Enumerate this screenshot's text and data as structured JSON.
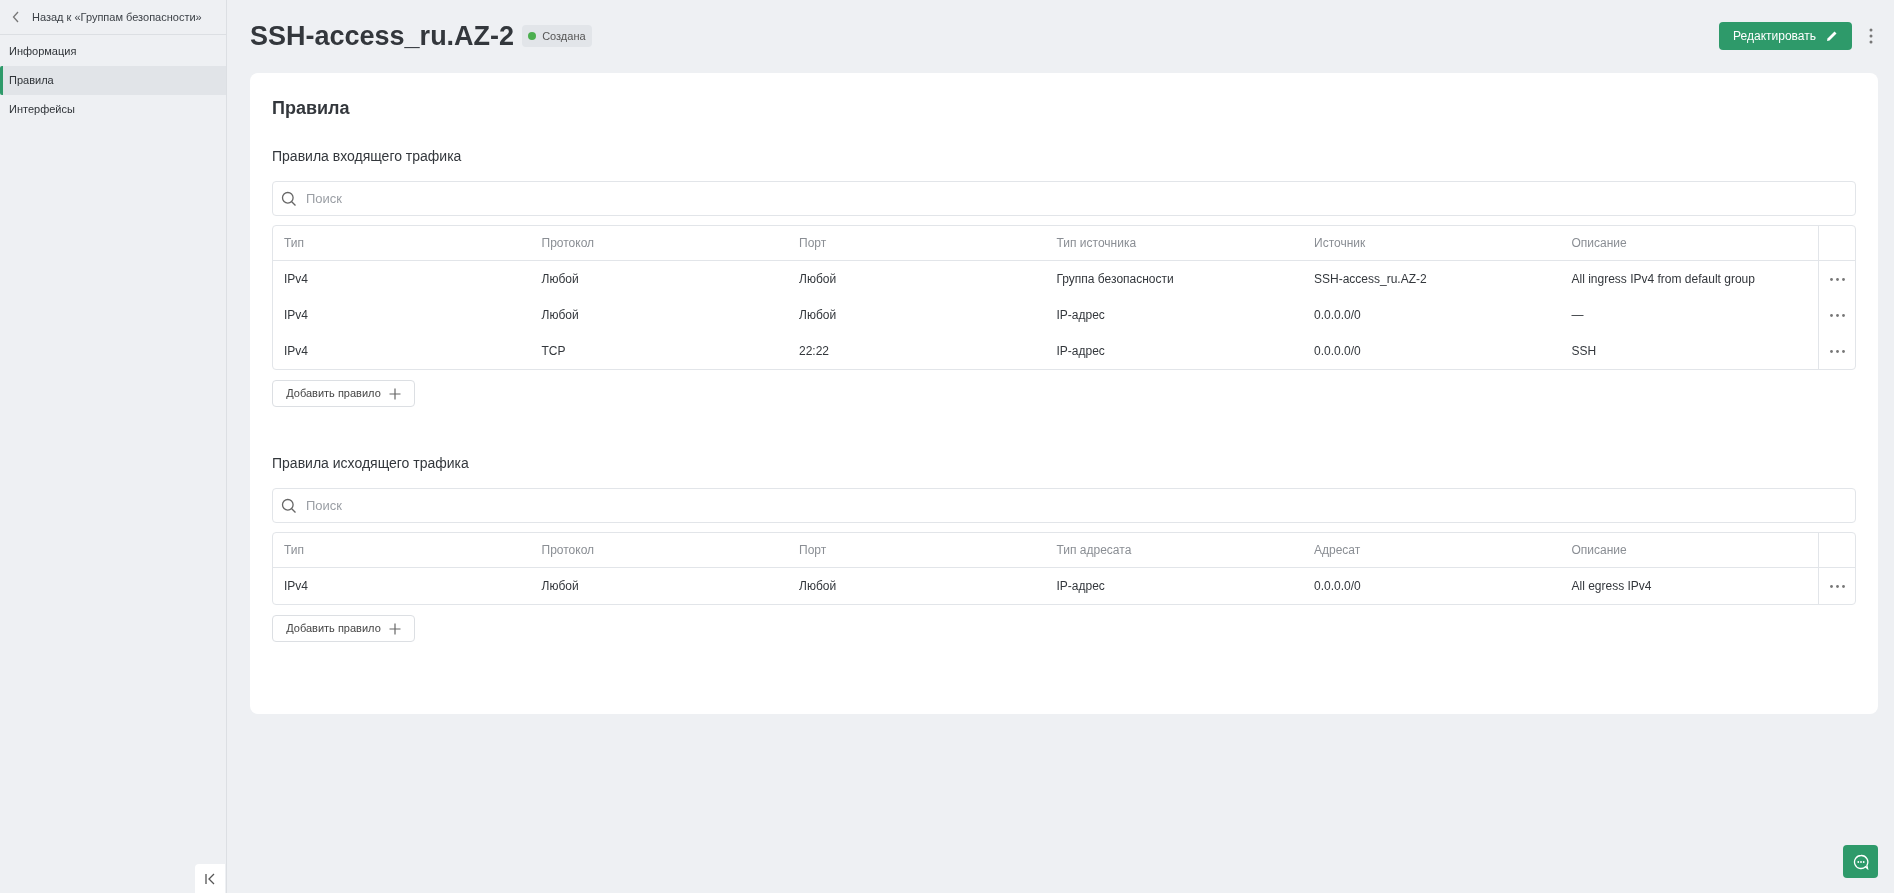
{
  "sidebar": {
    "back_link": "Назад к «Группам безопасности»",
    "items": [
      {
        "label": "Информация",
        "selected": false
      },
      {
        "label": "Правила",
        "selected": true
      },
      {
        "label": "Интерфейсы",
        "selected": false
      }
    ]
  },
  "header": {
    "title": "SSH-access_ru.AZ-2",
    "status": {
      "label": "Создана",
      "color": "#4caf50"
    },
    "edit_button": "Редактировать"
  },
  "card": {
    "title": "Правила",
    "sections": [
      {
        "title": "Правила входящего трафика",
        "search": {
          "placeholder": "Поиск"
        },
        "columns": [
          "Тип",
          "Протокол",
          "Порт",
          "Тип источника",
          "Источник",
          "Описание"
        ],
        "rows": [
          [
            "IPv4",
            "Любой",
            "Любой",
            "Группа безопасности",
            "SSH-access_ru.AZ-2",
            "All ingress IPv4 from default group"
          ],
          [
            "IPv4",
            "Любой",
            "Любой",
            "IP-адрес",
            "0.0.0.0/0",
            "—"
          ],
          [
            "IPv4",
            "TCP",
            "22:22",
            "IP-адрес",
            "0.0.0.0/0",
            "SSH"
          ]
        ],
        "add_button": "Добавить правило"
      },
      {
        "title": "Правила исходящего трафика",
        "search": {
          "placeholder": "Поиск"
        },
        "columns": [
          "Тип",
          "Протокол",
          "Порт",
          "Тип адресата",
          "Адресат",
          "Описание"
        ],
        "rows": [
          [
            "IPv4",
            "Любой",
            "Любой",
            "IP-адрес",
            "0.0.0.0/0",
            "All egress IPv4"
          ]
        ],
        "add_button": "Добавить правило"
      }
    ]
  }
}
